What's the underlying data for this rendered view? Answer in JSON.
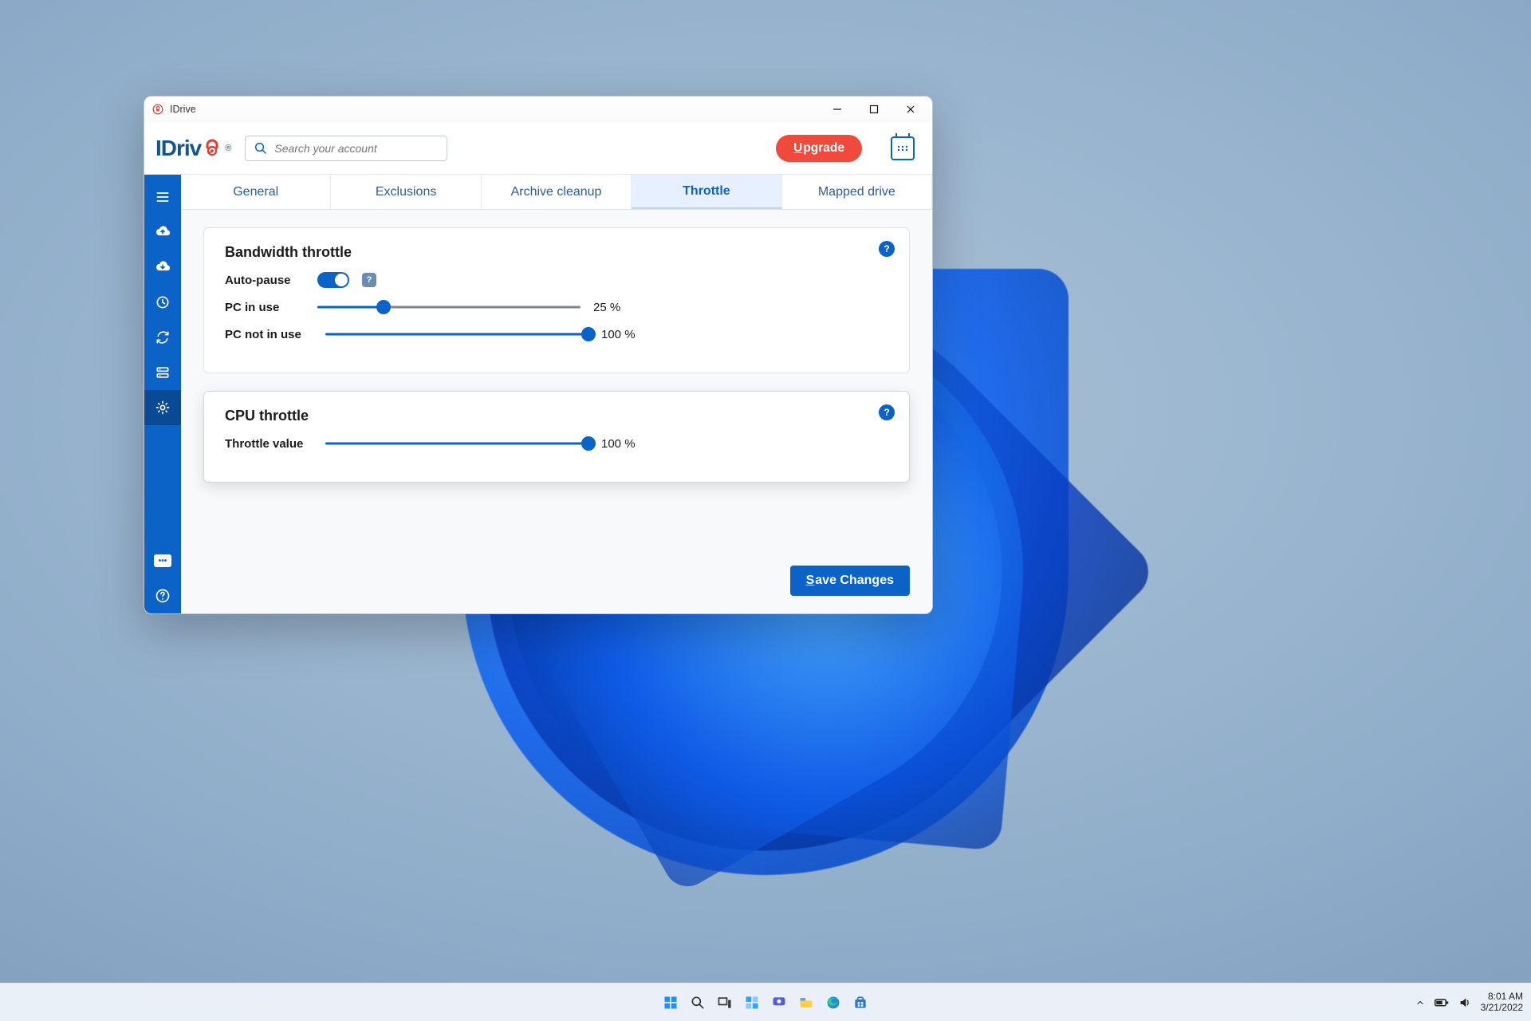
{
  "window": {
    "title": "IDrive"
  },
  "logo": {
    "text_pre": "IDriv",
    "brand_e": "e",
    "reg": "®"
  },
  "search": {
    "placeholder": "Search your account"
  },
  "header": {
    "upgrade": "pgrade",
    "upgrade_u": "U"
  },
  "tabs": {
    "general": "General",
    "exclusions": "Exclusions",
    "archive": "Archive cleanup",
    "throttle": "Throttle",
    "mapped": "Mapped drive"
  },
  "bandwidth": {
    "title": "Bandwidth throttle",
    "autopause_label": "Auto-pause",
    "pc_in_use_label": "PC in use",
    "pc_in_use_value": "25 %",
    "pc_in_use_pct": 25,
    "pc_not_in_use_label": "PC not in use",
    "pc_not_in_use_value": "100 %",
    "pc_not_in_use_pct": 100
  },
  "cpu": {
    "title": "CPU throttle",
    "throttle_label": "Throttle value",
    "throttle_value": "100 %",
    "throttle_pct": 100
  },
  "save": {
    "label": "ave Changes",
    "underline": "S"
  },
  "systray": {
    "time": "8:01 AM",
    "date": "3/21/2022"
  }
}
